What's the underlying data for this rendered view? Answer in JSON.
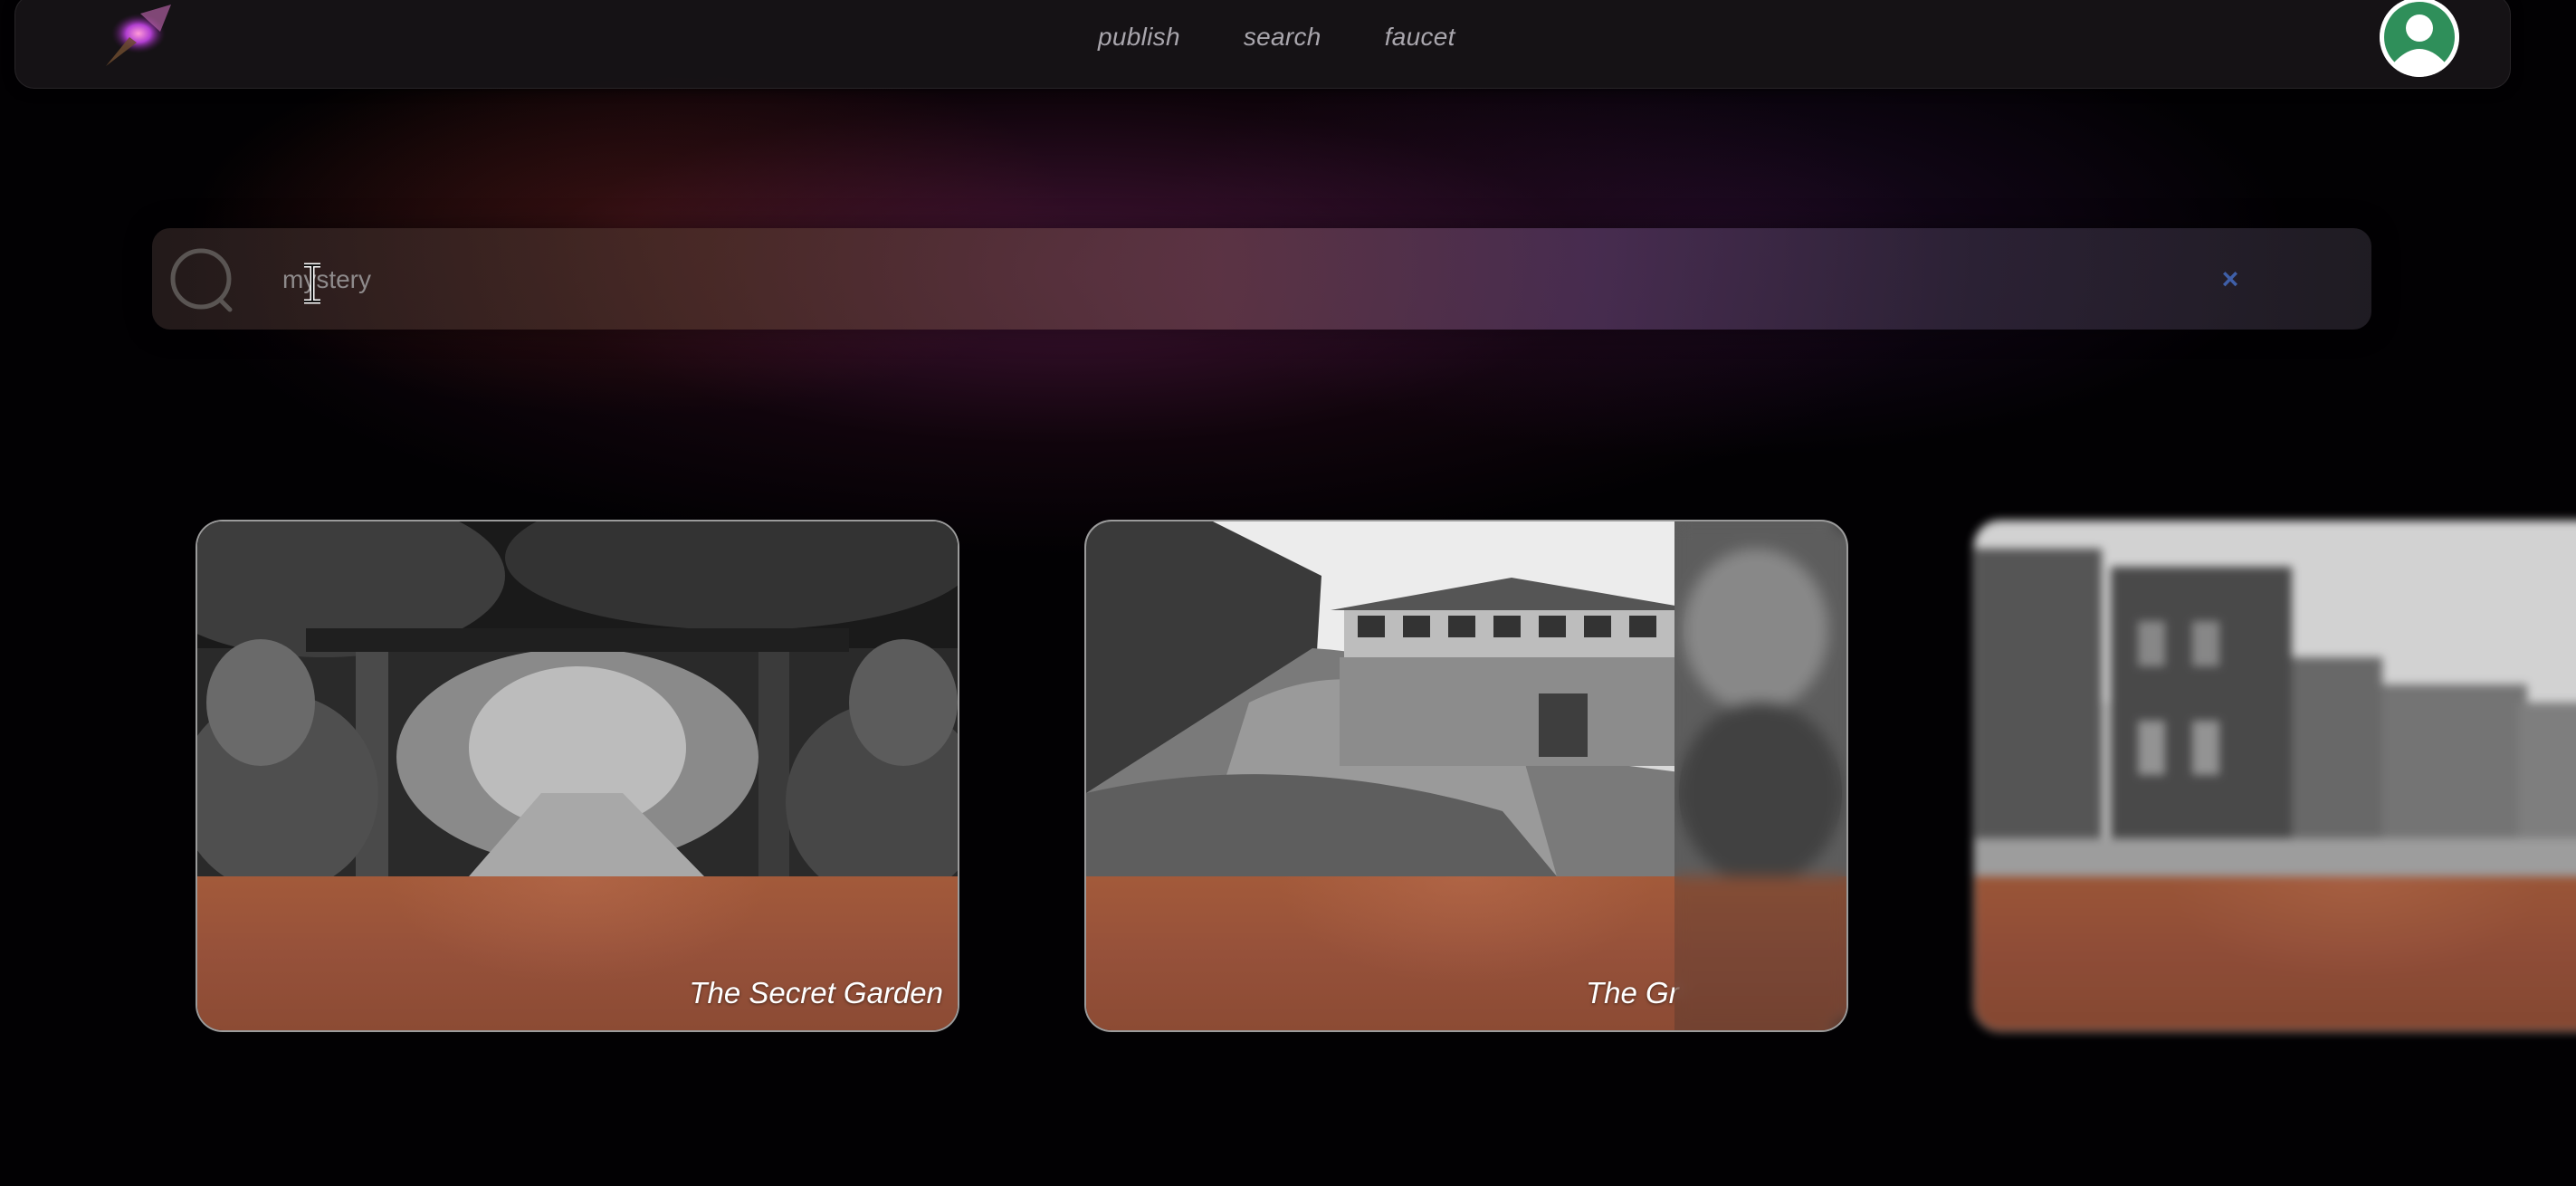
{
  "nav": {
    "links": [
      "publish",
      "search",
      "faucet"
    ],
    "logo_icon": "purple-rocket-logo",
    "avatar_icon": "user-avatar-icon",
    "colors": {
      "bar": "#161316",
      "link": "#a9a6ad",
      "avatar_bg": "#2f8f5a"
    }
  },
  "search": {
    "value": "mystery",
    "placeholder": "",
    "clear_label": "×",
    "icon": "search-icon",
    "colors": {
      "clear": "#3f5fa8"
    }
  },
  "results": [
    {
      "title": "The Secret Garden",
      "image": "garden-arbor-photo"
    },
    {
      "title": "The Gr",
      "image": "cottage-on-hill-photo"
    },
    {
      "title": "",
      "image": "street-houses-photo"
    }
  ],
  "colors": {
    "card_footer": "#96513a",
    "background_glow": "#781f5f"
  }
}
